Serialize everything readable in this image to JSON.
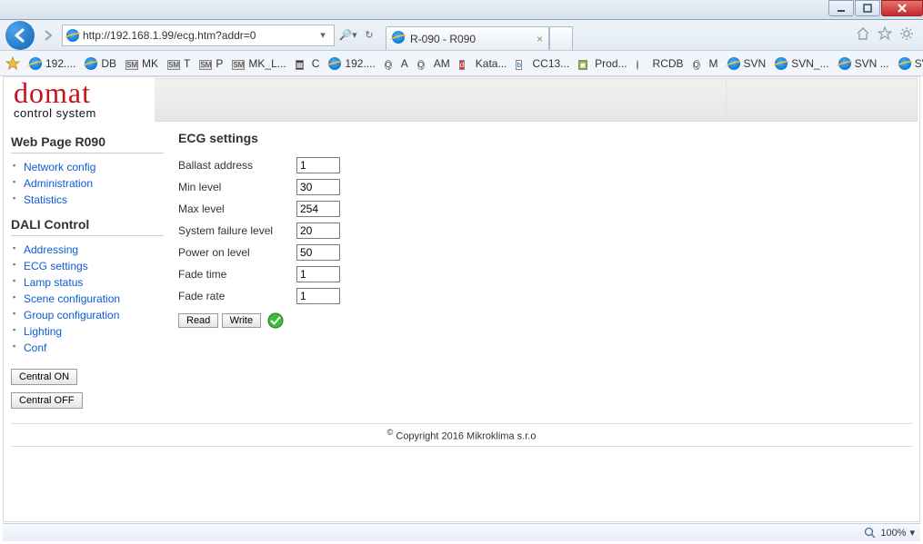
{
  "window": {
    "url": "http://192.168.1.99/ecg.htm?addr=0",
    "search_hint": "",
    "tab_title": "R-090 - R090"
  },
  "favorites": [
    {
      "label": "192....",
      "kind": "ie"
    },
    {
      "label": "DB",
      "kind": "ie"
    },
    {
      "label": "MK",
      "kind": "sm"
    },
    {
      "label": "T",
      "kind": "sm"
    },
    {
      "label": "P",
      "kind": "sm"
    },
    {
      "label": "MK_L...",
      "kind": "sm"
    },
    {
      "label": "C",
      "kind": "cal"
    },
    {
      "label": "192....",
      "kind": "ie"
    },
    {
      "label": "A",
      "kind": "q"
    },
    {
      "label": "AM",
      "kind": "q"
    },
    {
      "label": "Kata...",
      "kind": "d"
    },
    {
      "label": "CC13...",
      "kind": "b"
    },
    {
      "label": "Prod...",
      "kind": "p"
    },
    {
      "label": "RCDB",
      "kind": "globe"
    },
    {
      "label": "M",
      "kind": "q"
    },
    {
      "label": "SVN",
      "kind": "ie"
    },
    {
      "label": "SVN_...",
      "kind": "ie"
    },
    {
      "label": "SVN ...",
      "kind": "ie"
    }
  ],
  "logo": {
    "name": "domat",
    "sub": "control system"
  },
  "sidebar": {
    "page_h": "Web Page R090",
    "group1": [
      {
        "label": "Network config"
      },
      {
        "label": "Administration"
      },
      {
        "label": "Statistics"
      }
    ],
    "dali_h": "DALI Control",
    "group2": [
      {
        "label": "Addressing"
      },
      {
        "label": "ECG settings"
      },
      {
        "label": "Lamp status"
      },
      {
        "label": "Scene configuration"
      },
      {
        "label": "Group configuration"
      },
      {
        "label": "Lighting"
      },
      {
        "label": "Conf"
      }
    ],
    "central_on": "Central ON",
    "central_off": "Central OFF"
  },
  "main": {
    "title": "ECG settings",
    "fields": {
      "ballast_addr": {
        "label": "Ballast address",
        "value": "1"
      },
      "min_level": {
        "label": "Min level",
        "value": "30"
      },
      "max_level": {
        "label": "Max level",
        "value": "254"
      },
      "sys_fail": {
        "label": "System failure level",
        "value": "20"
      },
      "power_on": {
        "label": "Power on level",
        "value": "50"
      },
      "fade_time": {
        "label": "Fade time",
        "value": "1"
      },
      "fade_rate": {
        "label": "Fade rate",
        "value": "1"
      }
    },
    "read_btn": "Read",
    "write_btn": "Write"
  },
  "footer": "Copyright 2016 Mikroklima s.r.o",
  "status": {
    "zoom": "100%"
  }
}
